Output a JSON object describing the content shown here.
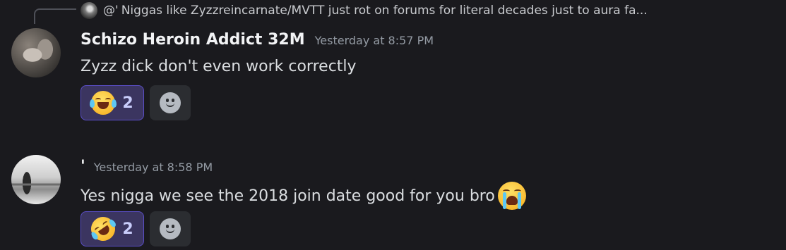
{
  "reply": {
    "author": "@'",
    "text": "Niggas like Zyzzreincarnate/MVTT just rot on forums for literal decades just to aura fa..."
  },
  "messages": [
    {
      "username": "Schizo Heroin Addict 32M",
      "timestamp": "Yesterday at 8:57 PM",
      "content": "Zyzz dick don't even work correctly",
      "reaction": {
        "emoji": "joy-emoji",
        "count": "2"
      }
    },
    {
      "username": "'",
      "timestamp": "Yesterday at 8:58 PM",
      "content": "Yes nigga we see the 2018 join date good for you bro",
      "inline_emoji": "sob-emoji",
      "reaction": {
        "emoji": "rofl-emoji",
        "count": "2"
      }
    }
  ],
  "colors": {
    "background": "#1a1a1e",
    "reaction_active_bg": "#3b3560",
    "reaction_active_border": "#5a4ec5",
    "timestamp": "#949ba4"
  }
}
